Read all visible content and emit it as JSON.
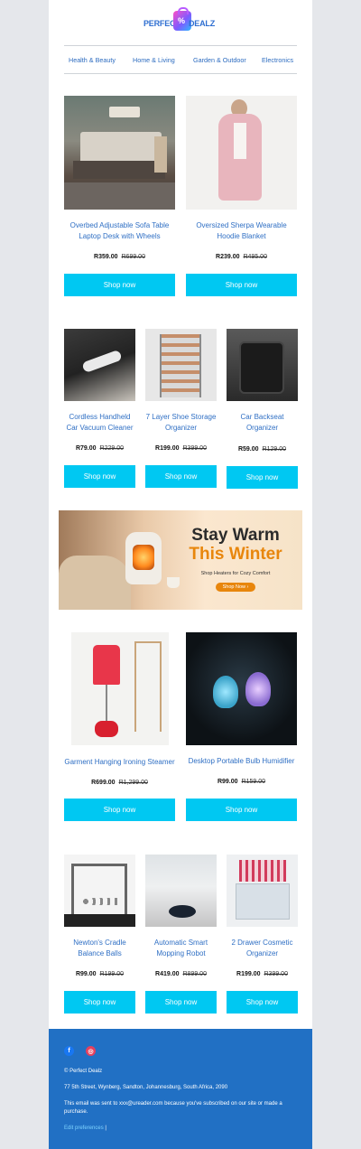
{
  "brand": {
    "word1": "PERFECT",
    "word2": "DEALZ"
  },
  "nav": [
    {
      "label": "Health & Beauty"
    },
    {
      "label": "Home & Living"
    },
    {
      "label": "Garden & Outdoor"
    },
    {
      "label": "Electronics"
    }
  ],
  "section1": [
    {
      "title": "Overbed Adjustable Sofa Table Laptop Desk with Wheels",
      "price": "R359.00",
      "was": "R699.00",
      "button": "Shop now"
    },
    {
      "title": "Oversized Sherpa Wearable Hoodie Blanket",
      "price": "R239.00",
      "was": "R495.00",
      "button": "Shop now"
    }
  ],
  "section2": [
    {
      "title": "Cordless Handheld Car Vacuum Cleaner",
      "price": "R79.00",
      "was": "R229.00",
      "button": "Shop now"
    },
    {
      "title": "7 Layer Shoe Storage Organizer",
      "price": "R199.00",
      "was": "R399.00",
      "button": "Shop now"
    },
    {
      "title": "Car Backseat Organizer",
      "price": "R59.00",
      "was": "R129.00",
      "button": "Shop now"
    }
  ],
  "banner": {
    "line1": "Stay Warm",
    "line2": "This Winter",
    "sub": "Shop Heaters for Cozy Comfort",
    "cta": "Shop Now"
  },
  "section3": [
    {
      "title": "Garment Hanging Ironing Steamer",
      "price": "R699.00",
      "was": "R1,299.00",
      "button": "Shop now"
    },
    {
      "title": "Desktop Portable Bulb Humidifier",
      "price": "R99.00",
      "was": "R159.00",
      "button": "Shop now"
    }
  ],
  "section4": [
    {
      "title": "Newton's Cradle Balance Balls",
      "price": "R99.00",
      "was": "R199.00",
      "button": "Shop now"
    },
    {
      "title": "Automatic Smart Mopping Robot",
      "price": "R419.00",
      "was": "R899.00",
      "button": "Shop now"
    },
    {
      "title": "2 Drawer Cosmetic Organizer",
      "price": "R199.00",
      "was": "R399.00",
      "button": "Shop now"
    }
  ],
  "footer": {
    "copyright": "© Perfect Dealz",
    "address": "77 5th Street, Wynberg, Sandton, Johannesburg, South Africa, 2090",
    "notice": "This email was sent to xxx@ureader.com because you've subscribed on our site or made a purchase.",
    "prefs": "Edit preferences",
    "sep": "|"
  },
  "social": [
    {
      "icon": "facebook-icon",
      "glyph": "f",
      "color": "#1877f2"
    },
    {
      "icon": "instagram-icon",
      "glyph": "◎",
      "color": "#e4405f"
    }
  ]
}
